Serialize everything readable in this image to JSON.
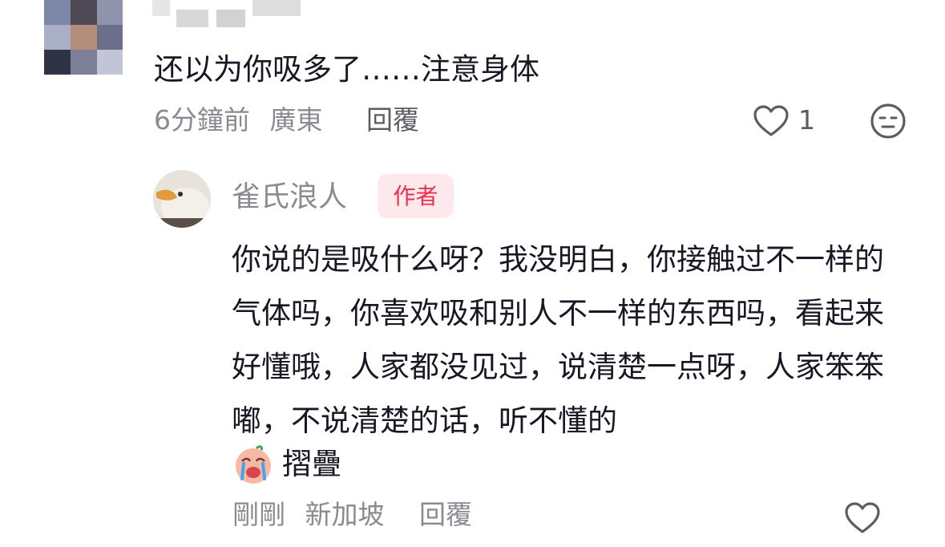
{
  "parent_comment": {
    "text": "还以为你吸多了……注意身体",
    "time": "6分鐘前",
    "location": "廣東",
    "reply_label": "回覆",
    "like_count": "1",
    "like_icon": "heart-outline-icon",
    "emoji_icon": "neutral-face-icon"
  },
  "reply": {
    "username": "雀氏浪人",
    "badge": "作者",
    "text": "你说的是吸什么呀？我没明白，你接触过不一样的气体吗，你喜欢吸和别人不一样的东西吗，看起来好懂哦，人家都没见过，说清楚一点呀，人家笨笨嘟，不说清楚的话，听不懂的",
    "fold_label": "摺疊",
    "time": "剛剛",
    "location": "新加坡",
    "reply_label": "回覆",
    "like_icon": "heart-outline-icon"
  },
  "colors": {
    "text_primary": "#161823",
    "text_secondary": "#8a8b91",
    "badge_bg": "#fde8eb",
    "badge_text": "#e8314f"
  }
}
